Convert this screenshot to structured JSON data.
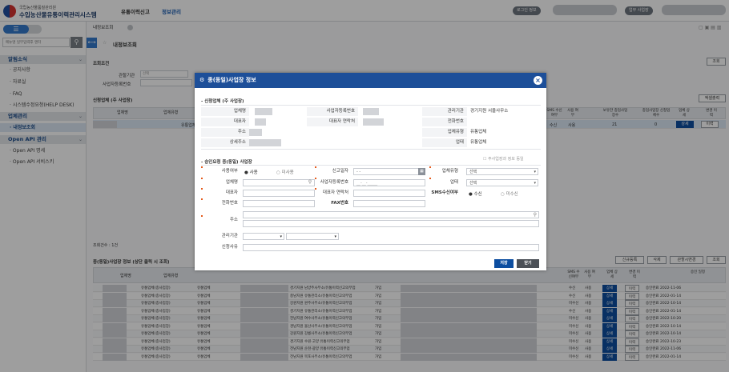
{
  "header": {
    "org_name": "국립농산물품질관리원",
    "system_name": "수입농산물유통이력관리시스템",
    "menu": [
      "유통이력신고",
      "정보관리"
    ],
    "login_info_label": "로그인 정보",
    "business_place_label": "업무 사업장"
  },
  "sidebar": {
    "search_placeholder": "메뉴명 일부입력후 엔터",
    "groups": [
      {
        "label": "알림소식",
        "items": [
          "· 공지사항",
          "· 자료실",
          "· FAQ",
          "· 시스템수정요청(HELP DESK)"
        ]
      },
      {
        "label": "업체관리",
        "items": [
          "· 내정보조회"
        ]
      },
      {
        "label": "Open API 관리",
        "items": [
          "· Open API 명세",
          "· Open API 서비스키"
        ]
      }
    ]
  },
  "tabs": {
    "active": "내정보조회"
  },
  "page": {
    "title": "내정보조회",
    "search_section": "조회조건",
    "search_button": "조회",
    "filter_labels": [
      "관할기관",
      "업체유형",
      "사업자등록번호"
    ],
    "filter_select_value": "선택",
    "list_section": "신청업체 (주 사업장)",
    "excel_button": "엑셀출력",
    "list_headers": [
      "업체명",
      "업체유형",
      "SMS 수신여부",
      "사용 여부",
      "보유한 종업사업장수",
      "종업사업장 신청업체수",
      "업체 상세",
      "변경 이력"
    ],
    "list_row": {
      "type": "유통업체",
      "sms": "수신",
      "use": "사용",
      "count": "21",
      "count2": "0",
      "detail": "상세",
      "history": "이력"
    },
    "count_text": "조회건수 : 1건",
    "sub_section": "종(동일)사업장 정보 (상단 클릭 시 조회)",
    "sub_buttons": [
      "신규등록",
      "삭제",
      "관할시변경",
      "조회"
    ],
    "sub_headers": [
      "업체명",
      "업체유형",
      "SMS 수신여부",
      "사용 여부",
      "업체 상세",
      "변경 이력",
      "승인 결정상태",
      "유통일자",
      "승인 일정"
    ],
    "sub_rows": [
      {
        "type": "유통업체(종사업장)",
        "type2": "유통업체",
        "addr": "경기지원 남양주사무소/유통이력신고의무업",
        "stat": "가입",
        "sms": "수신",
        "use": "사용",
        "approve": "승인완료",
        "date": "2022-11-06"
      },
      {
        "type": "유통업체(종사업장)",
        "type2": "유통업체",
        "addr": "충남지원 유통관리소/유통이력신고의무업",
        "stat": "가입",
        "sms": "수신",
        "use": "사용",
        "approve": "승인완료",
        "date": "2022-01-14"
      },
      {
        "type": "유통업체(종사업장)",
        "type2": "유통업체",
        "addr": "강원지원 원주사무소/유통이력신고의무업",
        "stat": "가입",
        "sms": "미수신",
        "use": "사용",
        "approve": "승인완료",
        "date": "2022-10-14"
      },
      {
        "type": "유통업체(종사업장)",
        "type2": "유통업체",
        "addr": "경기지원 유통관리소/유통이력신고의무업",
        "stat": "가입",
        "sms": "수신",
        "use": "사용",
        "approve": "승인완료",
        "date": "2022-01-14"
      },
      {
        "type": "유통업체(종사업장)",
        "type2": "유통업체",
        "addr": "전남지원 여수사무소/유통이력신고의무업",
        "stat": "가입",
        "sms": "미수신",
        "use": "사용",
        "approve": "승인완료",
        "date": "2022-10-20"
      },
      {
        "type": "유통업체(종사업장)",
        "type2": "유통업체",
        "addr": "경남지원 울산사무소/유통이력신고의무업",
        "stat": "가입",
        "sms": "미수신",
        "use": "사용",
        "approve": "승인완료",
        "date": "2022-10-14"
      },
      {
        "type": "유통업체(종사업장)",
        "type2": "유통업체",
        "addr": "강원지원 강릉사무소/유통이력신고의무업",
        "stat": "가입",
        "sms": "미수신",
        "use": "사용",
        "approve": "승인완료",
        "date": "2022-10-14"
      },
      {
        "type": "유통업체(종사업장)",
        "type2": "유통업체",
        "addr": "경기지원 수원·고양 유통이력신고의무업",
        "stat": "가입",
        "sms": "미수신",
        "use": "사용",
        "approve": "승인완료",
        "date": "2022-10-23"
      },
      {
        "type": "유통업체(종사업장)",
        "type2": "유통업체",
        "addr": "전남지원 순천·광양 유통이력신고의무업",
        "stat": "가입",
        "sms": "미수신",
        "use": "사용",
        "approve": "승인완료",
        "date": "2022-11-06"
      },
      {
        "type": "유통업체(종사업장)",
        "type2": "유통업체",
        "addr": "전남지원 목포사무소/유통이력신고의무업",
        "stat": "가입",
        "sms": "미수신",
        "use": "사용",
        "approve": "승인완료",
        "date": "2022-01-14"
      }
    ],
    "detail_label": "상세",
    "history_label": "이력"
  },
  "modal": {
    "title": "종(동일)사업장 정보",
    "section1": "신청업체 (주 사업장)",
    "s1_labels": {
      "company": "업체명",
      "bizno": "사업자등록번호",
      "agency": "관리기관",
      "rep": "대표자",
      "rep_phone": "대표자 연락처",
      "phone": "전화번호",
      "addr": "주소",
      "biztype": "업체유형",
      "detail_addr": "상세주소",
      "industry": "업태"
    },
    "s1_values": {
      "agency": "경기지원 서울사무소",
      "biztype": "유통업체",
      "industry": "유통업체"
    },
    "section2": "승인요청 종(동일) 사업장",
    "copy_check": "주사업장과 정보 동일",
    "s2_labels": {
      "use": "사용여부",
      "report_date": "신고일자",
      "biztype": "업체유형",
      "company": "업체명",
      "bizno": "사업자등록번호",
      "industry": "업태",
      "rep": "대표자",
      "rep_phone": "대표자 연락처",
      "sms": "SMS수신여부",
      "phone": "전화번호",
      "fax": "FAX번호",
      "addr": "주소",
      "agency": "관리기관",
      "reason": "신청사유"
    },
    "use_options": [
      "사용",
      "미사용"
    ],
    "sms_options": [
      "수신",
      "미수신"
    ],
    "select_default": "선택",
    "date_placeholder": "-  -",
    "bizno_placeholder": "__-__-_____",
    "save_button": "저장",
    "close_button": "닫기"
  }
}
